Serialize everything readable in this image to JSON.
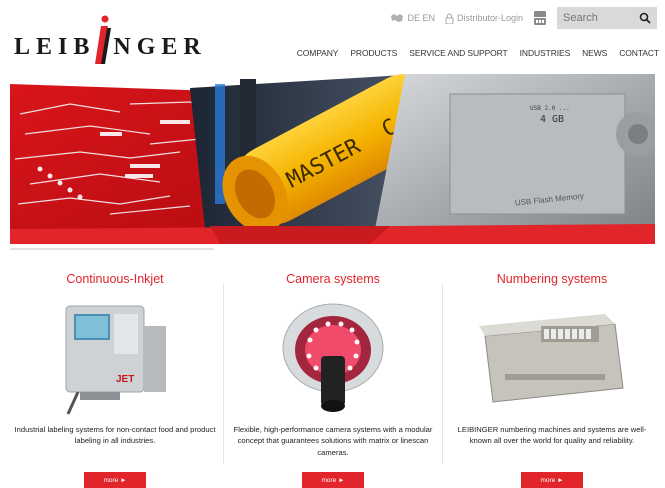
{
  "brand": {
    "name": "LEIBINGER",
    "name_left": "LEIB",
    "name_right": "NGER"
  },
  "topbar": {
    "lang_label": "DE  EN",
    "login_label": "Distributor-Login",
    "search_placeholder": "Search"
  },
  "nav": [
    "COMPANY",
    "PRODUCTS",
    "SERVICE AND SUPPORT",
    "INDUSTRIES",
    "NEWS",
    "CONTACT"
  ],
  "hero": {
    "roller_text": "MASTER",
    "roller_text_extra": "C",
    "usb_capacity": "4 GB",
    "usb_small": "USB 2.0 ...",
    "usb_label": "USB Flash Memory"
  },
  "products": [
    {
      "title": "Continuous-Inkjet",
      "description": "Industrial labeling systems for non-contact food and product labeling in all industries.",
      "button": "more ►"
    },
    {
      "title": "Camera systems",
      "description": "Flexible, high-performance camera systems with a modular concept that guarantees solutions with matrix or linescan cameras.",
      "button": "more ►"
    },
    {
      "title": "Numbering systems",
      "description": "LEIBINGER numbering machines and systems are well-known all over the world for quality and reliability.",
      "button": "more ►"
    }
  ],
  "colors": {
    "accent": "#e2242b",
    "nav_text": "#333333",
    "search_bg": "#d9d9d9"
  }
}
